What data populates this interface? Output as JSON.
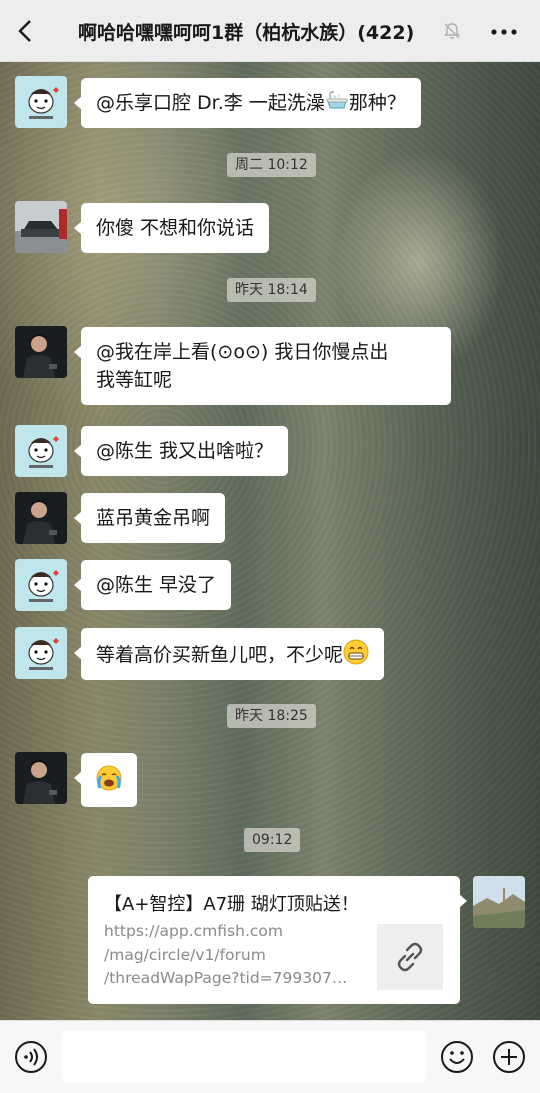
{
  "header": {
    "title": "啊哈哈嘿嘿呵呵1群（柏杭水族）(422)"
  },
  "messages": [
    {
      "text": "@乐享口腔 Dr.李  一起洗澡",
      "suffix": "那种？",
      "emoji": "bathtub"
    },
    {
      "time": "周二 10:12"
    },
    {
      "text": "你傻 不想和你说话"
    },
    {
      "time": "昨天 18:14"
    },
    {
      "line1": "@我在岸上看(⊙o⊙) 我日你慢点出",
      "line2": "我等缸呢"
    },
    {
      "text": "@陈生  我又出啥啦？"
    },
    {
      "text": "蓝吊黄金吊啊"
    },
    {
      "text": "@陈生  早没了"
    },
    {
      "text": "等着高价买新鱼儿吧，不少呢",
      "emoji": "grin"
    },
    {
      "time": "昨天 18:25"
    },
    {
      "emoji": "sob"
    },
    {
      "time": "09:12"
    }
  ],
  "link_card": {
    "title": "【A+智控】A7珊 瑚灯顶贴送！",
    "url_lines": [
      "https://app.cmfish.com",
      "/mag/circle/v1/forum",
      "/threadWapPage?tid=799307…"
    ],
    "icon": "link-icon"
  },
  "bottom_bar": {
    "icons": [
      "voice-icon",
      "emoji-icon",
      "plus-icon"
    ]
  },
  "colors": {
    "header_bg": "#ededed",
    "bubble_bg": "#ffffff",
    "bottom_bg": "#f7f7f7"
  }
}
